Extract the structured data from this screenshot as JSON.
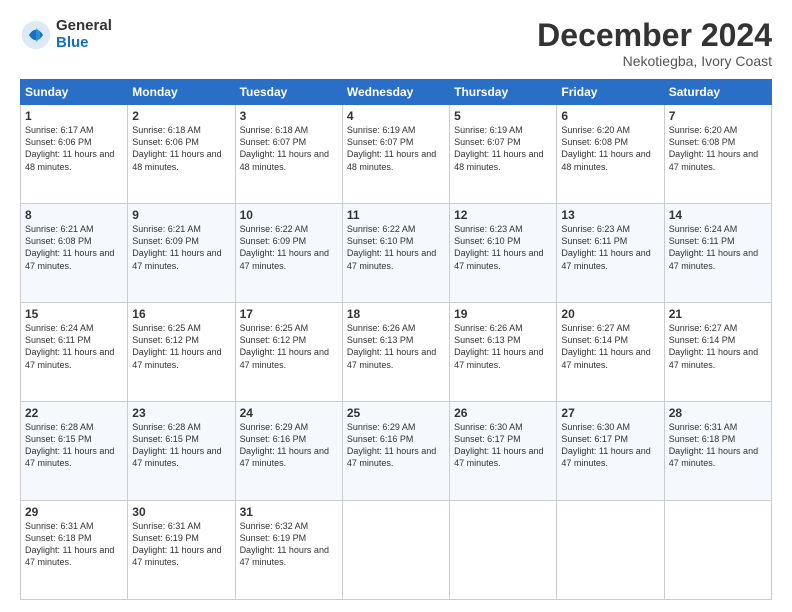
{
  "logo": {
    "general": "General",
    "blue": "Blue"
  },
  "title": {
    "month": "December 2024",
    "location": "Nekotiegba, Ivory Coast"
  },
  "weekdays": [
    "Sunday",
    "Monday",
    "Tuesday",
    "Wednesday",
    "Thursday",
    "Friday",
    "Saturday"
  ],
  "weeks": [
    [
      {
        "day": "1",
        "sunrise": "6:17 AM",
        "sunset": "6:06 PM",
        "daylight": "11 hours and 48 minutes."
      },
      {
        "day": "2",
        "sunrise": "6:18 AM",
        "sunset": "6:06 PM",
        "daylight": "11 hours and 48 minutes."
      },
      {
        "day": "3",
        "sunrise": "6:18 AM",
        "sunset": "6:07 PM",
        "daylight": "11 hours and 48 minutes."
      },
      {
        "day": "4",
        "sunrise": "6:19 AM",
        "sunset": "6:07 PM",
        "daylight": "11 hours and 48 minutes."
      },
      {
        "day": "5",
        "sunrise": "6:19 AM",
        "sunset": "6:07 PM",
        "daylight": "11 hours and 48 minutes."
      },
      {
        "day": "6",
        "sunrise": "6:20 AM",
        "sunset": "6:08 PM",
        "daylight": "11 hours and 48 minutes."
      },
      {
        "day": "7",
        "sunrise": "6:20 AM",
        "sunset": "6:08 PM",
        "daylight": "11 hours and 47 minutes."
      }
    ],
    [
      {
        "day": "8",
        "sunrise": "6:21 AM",
        "sunset": "6:08 PM",
        "daylight": "11 hours and 47 minutes."
      },
      {
        "day": "9",
        "sunrise": "6:21 AM",
        "sunset": "6:09 PM",
        "daylight": "11 hours and 47 minutes."
      },
      {
        "day": "10",
        "sunrise": "6:22 AM",
        "sunset": "6:09 PM",
        "daylight": "11 hours and 47 minutes."
      },
      {
        "day": "11",
        "sunrise": "6:22 AM",
        "sunset": "6:10 PM",
        "daylight": "11 hours and 47 minutes."
      },
      {
        "day": "12",
        "sunrise": "6:23 AM",
        "sunset": "6:10 PM",
        "daylight": "11 hours and 47 minutes."
      },
      {
        "day": "13",
        "sunrise": "6:23 AM",
        "sunset": "6:11 PM",
        "daylight": "11 hours and 47 minutes."
      },
      {
        "day": "14",
        "sunrise": "6:24 AM",
        "sunset": "6:11 PM",
        "daylight": "11 hours and 47 minutes."
      }
    ],
    [
      {
        "day": "15",
        "sunrise": "6:24 AM",
        "sunset": "6:11 PM",
        "daylight": "11 hours and 47 minutes."
      },
      {
        "day": "16",
        "sunrise": "6:25 AM",
        "sunset": "6:12 PM",
        "daylight": "11 hours and 47 minutes."
      },
      {
        "day": "17",
        "sunrise": "6:25 AM",
        "sunset": "6:12 PM",
        "daylight": "11 hours and 47 minutes."
      },
      {
        "day": "18",
        "sunrise": "6:26 AM",
        "sunset": "6:13 PM",
        "daylight": "11 hours and 47 minutes."
      },
      {
        "day": "19",
        "sunrise": "6:26 AM",
        "sunset": "6:13 PM",
        "daylight": "11 hours and 47 minutes."
      },
      {
        "day": "20",
        "sunrise": "6:27 AM",
        "sunset": "6:14 PM",
        "daylight": "11 hours and 47 minutes."
      },
      {
        "day": "21",
        "sunrise": "6:27 AM",
        "sunset": "6:14 PM",
        "daylight": "11 hours and 47 minutes."
      }
    ],
    [
      {
        "day": "22",
        "sunrise": "6:28 AM",
        "sunset": "6:15 PM",
        "daylight": "11 hours and 47 minutes."
      },
      {
        "day": "23",
        "sunrise": "6:28 AM",
        "sunset": "6:15 PM",
        "daylight": "11 hours and 47 minutes."
      },
      {
        "day": "24",
        "sunrise": "6:29 AM",
        "sunset": "6:16 PM",
        "daylight": "11 hours and 47 minutes."
      },
      {
        "day": "25",
        "sunrise": "6:29 AM",
        "sunset": "6:16 PM",
        "daylight": "11 hours and 47 minutes."
      },
      {
        "day": "26",
        "sunrise": "6:30 AM",
        "sunset": "6:17 PM",
        "daylight": "11 hours and 47 minutes."
      },
      {
        "day": "27",
        "sunrise": "6:30 AM",
        "sunset": "6:17 PM",
        "daylight": "11 hours and 47 minutes."
      },
      {
        "day": "28",
        "sunrise": "6:31 AM",
        "sunset": "6:18 PM",
        "daylight": "11 hours and 47 minutes."
      }
    ],
    [
      {
        "day": "29",
        "sunrise": "6:31 AM",
        "sunset": "6:18 PM",
        "daylight": "11 hours and 47 minutes."
      },
      {
        "day": "30",
        "sunrise": "6:31 AM",
        "sunset": "6:19 PM",
        "daylight": "11 hours and 47 minutes."
      },
      {
        "day": "31",
        "sunrise": "6:32 AM",
        "sunset": "6:19 PM",
        "daylight": "11 hours and 47 minutes."
      },
      null,
      null,
      null,
      null
    ]
  ]
}
